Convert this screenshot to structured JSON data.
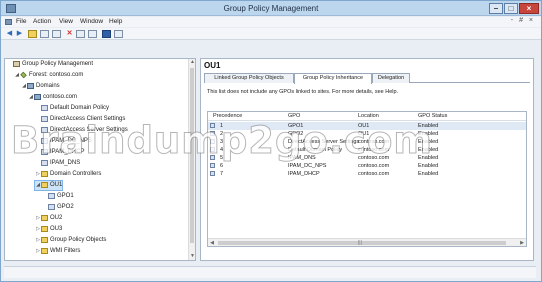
{
  "window": {
    "title": "Group Policy Management"
  },
  "menu": [
    {
      "label": "File",
      "accel": "F"
    },
    {
      "label": "Action",
      "accel": "A"
    },
    {
      "label": "View",
      "accel": "V"
    },
    {
      "label": "Window",
      "accel": "W"
    },
    {
      "label": "Help",
      "accel": "H"
    }
  ],
  "menu_right": "- # ×",
  "tree": [
    {
      "label": "Group Policy Management",
      "icon": "gp",
      "expander": "",
      "depth": 0
    },
    {
      "label": "Forest: contoso.com",
      "icon": "forest",
      "expander": "◢",
      "depth": 1
    },
    {
      "label": "Domains",
      "icon": "domain",
      "expander": "◢",
      "depth": 2
    },
    {
      "label": "contoso.com",
      "icon": "domain",
      "expander": "◢",
      "depth": 3
    },
    {
      "label": "Default Domain Policy",
      "icon": "gpo",
      "expander": "",
      "depth": 4
    },
    {
      "label": "DirectAccess Client Settings",
      "icon": "gpo",
      "expander": "",
      "depth": 4
    },
    {
      "label": "DirectAccess Server Settings",
      "icon": "gpo",
      "expander": "",
      "depth": 4
    },
    {
      "label": "IPAM_DC_NPS",
      "icon": "gpo",
      "expander": "",
      "depth": 4
    },
    {
      "label": "IPAM_DHCP",
      "icon": "gpo",
      "expander": "",
      "depth": 4
    },
    {
      "label": "IPAM_DNS",
      "icon": "gpo",
      "expander": "",
      "depth": 4
    },
    {
      "label": "Domain Controllers",
      "icon": "ou",
      "expander": "▷",
      "depth": 4
    },
    {
      "label": "OU1",
      "icon": "ou",
      "expander": "◢",
      "depth": 4,
      "selected": true
    },
    {
      "label": "GPO1",
      "icon": "gpo",
      "expander": "",
      "depth": 5
    },
    {
      "label": "GPO2",
      "icon": "gpo",
      "expander": "",
      "depth": 5
    },
    {
      "label": "OU2",
      "icon": "ou",
      "expander": "▷",
      "depth": 4
    },
    {
      "label": "OU3",
      "icon": "ou",
      "expander": "▷",
      "depth": 4
    },
    {
      "label": "Group Policy Objects",
      "icon": "folder",
      "expander": "▷",
      "depth": 4
    },
    {
      "label": "WMI Filters",
      "icon": "wmi",
      "expander": "▷",
      "depth": 4
    }
  ],
  "right": {
    "title": "OU1",
    "tabs": [
      "Linked Group Policy Objects",
      "Group Policy Inheritance",
      "Delegation"
    ],
    "active_tab": 1,
    "info": "This list does not include any GPOs linked to sites. For more details, see Help.",
    "columns": [
      "Precedence",
      "GPO",
      "Location",
      "GPO Status"
    ],
    "rows": [
      {
        "precedence": "1",
        "gpo": "GPO1",
        "location": "OU1",
        "status": "Enabled"
      },
      {
        "precedence": "2",
        "gpo": "GPO2",
        "location": "OU1",
        "status": "Enabled"
      },
      {
        "precedence": "3",
        "gpo": "DirectAccess Server Settings",
        "location": "contoso.com",
        "status": "Enabled"
      },
      {
        "precedence": "4",
        "gpo": "Default Domain Policy",
        "location": "contoso.com",
        "status": "Enabled"
      },
      {
        "precedence": "5",
        "gpo": "IPAM_DNS",
        "location": "contoso.com",
        "status": "Enabled"
      },
      {
        "precedence": "6",
        "gpo": "IPAM_DC_NPS",
        "location": "contoso.com",
        "status": "Enabled"
      },
      {
        "precedence": "7",
        "gpo": "IPAM_DHCP",
        "location": "contoso.com",
        "status": "Enabled"
      }
    ]
  },
  "watermark": "Braindump2go.com"
}
